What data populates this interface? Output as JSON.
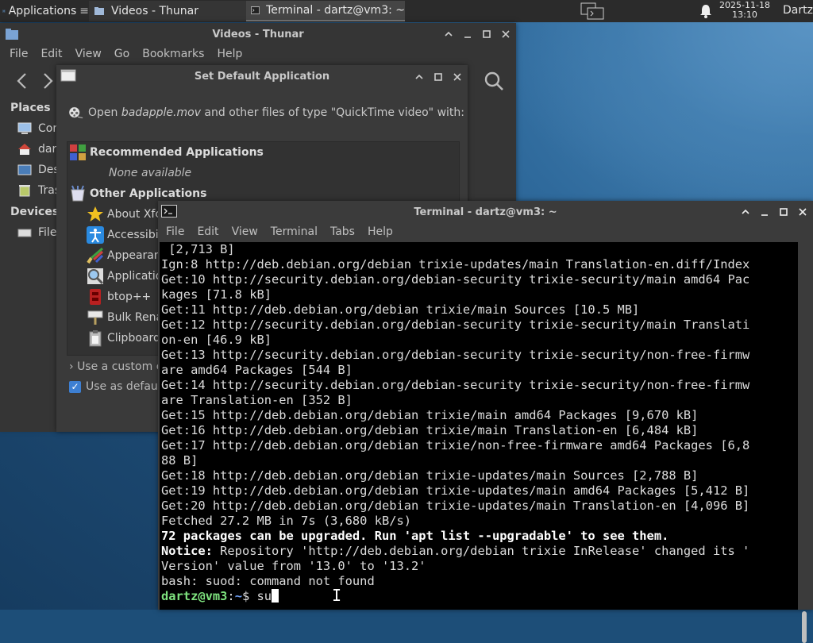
{
  "panel": {
    "apps_label": "Applications",
    "tasks": [
      "Videos - Thunar",
      "Terminal - dartz@vm3: ~"
    ],
    "clock_date": "2025-11-18",
    "clock_time": "13:10",
    "user": "Dartz"
  },
  "thunar": {
    "title": "Videos - Thunar",
    "menu": [
      "File",
      "Edit",
      "View",
      "Go",
      "Bookmarks",
      "Help"
    ],
    "places_heading": "Places",
    "places": [
      "Cor",
      "dar",
      "Des",
      "Tras"
    ],
    "devices_heading": "Devices",
    "devices": [
      "File"
    ]
  },
  "dialog": {
    "title": "Set Default Application",
    "header_prefix": "Open ",
    "header_file": "badapple.mov",
    "header_suffix": " and other files of type \"QuickTime video\" with:",
    "recommended_heading": "Recommended Applications",
    "none_available": "None available",
    "other_heading": "Other Applications",
    "apps": [
      "About Xfc",
      "Accessibi",
      "Appearan",
      "Applicatio",
      "btop++",
      "Bulk Rena",
      "Clipboard"
    ],
    "custom_command": "Use a custom c",
    "use_default": "Use as defaul"
  },
  "terminal": {
    "title": "Terminal - dartz@vm3: ~",
    "menu": [
      "File",
      "Edit",
      "View",
      "Terminal",
      "Tabs",
      "Help"
    ],
    "lines": [
      " [2,713 B]",
      "Ign:8 http://deb.debian.org/debian trixie-updates/main Translation-en.diff/Index",
      "Get:10 http://security.debian.org/debian-security trixie-security/main amd64 Pac",
      "kages [71.8 kB]",
      "Get:11 http://deb.debian.org/debian trixie/main Sources [10.5 MB]",
      "Get:12 http://security.debian.org/debian-security trixie-security/main Translati",
      "on-en [46.9 kB]",
      "Get:13 http://security.debian.org/debian-security trixie-security/non-free-firmw",
      "are amd64 Packages [544 B]",
      "Get:14 http://security.debian.org/debian-security trixie-security/non-free-firmw",
      "are Translation-en [352 B]",
      "Get:15 http://deb.debian.org/debian trixie/main amd64 Packages [9,670 kB]",
      "Get:16 http://deb.debian.org/debian trixie/main Translation-en [6,484 kB]",
      "Get:17 http://deb.debian.org/debian trixie/non-free-firmware amd64 Packages [6,8",
      "88 B]",
      "Get:18 http://deb.debian.org/debian trixie-updates/main Sources [2,788 B]",
      "Get:19 http://deb.debian.org/debian trixie-updates/main amd64 Packages [5,412 B]",
      "Get:20 http://deb.debian.org/debian trixie-updates/main Translation-en [4,096 B]",
      "Fetched 27.2 MB in 7s (3,680 kB/s)"
    ],
    "upgrade_line": "72 packages can be upgraded. Run 'apt list --upgradable' to see them.",
    "notice_label": "Notice:",
    "notice_text": " Repository 'http://deb.debian.org/debian trixie InRelease' changed its '",
    "notice_cont": "Version' value from '13.0' to '13.2'",
    "error_line": "bash: suod: command not found",
    "prompt_user": "dartz@vm3",
    "prompt_sep": ":",
    "prompt_path": "~",
    "prompt_sign": "$ ",
    "input": "su"
  }
}
